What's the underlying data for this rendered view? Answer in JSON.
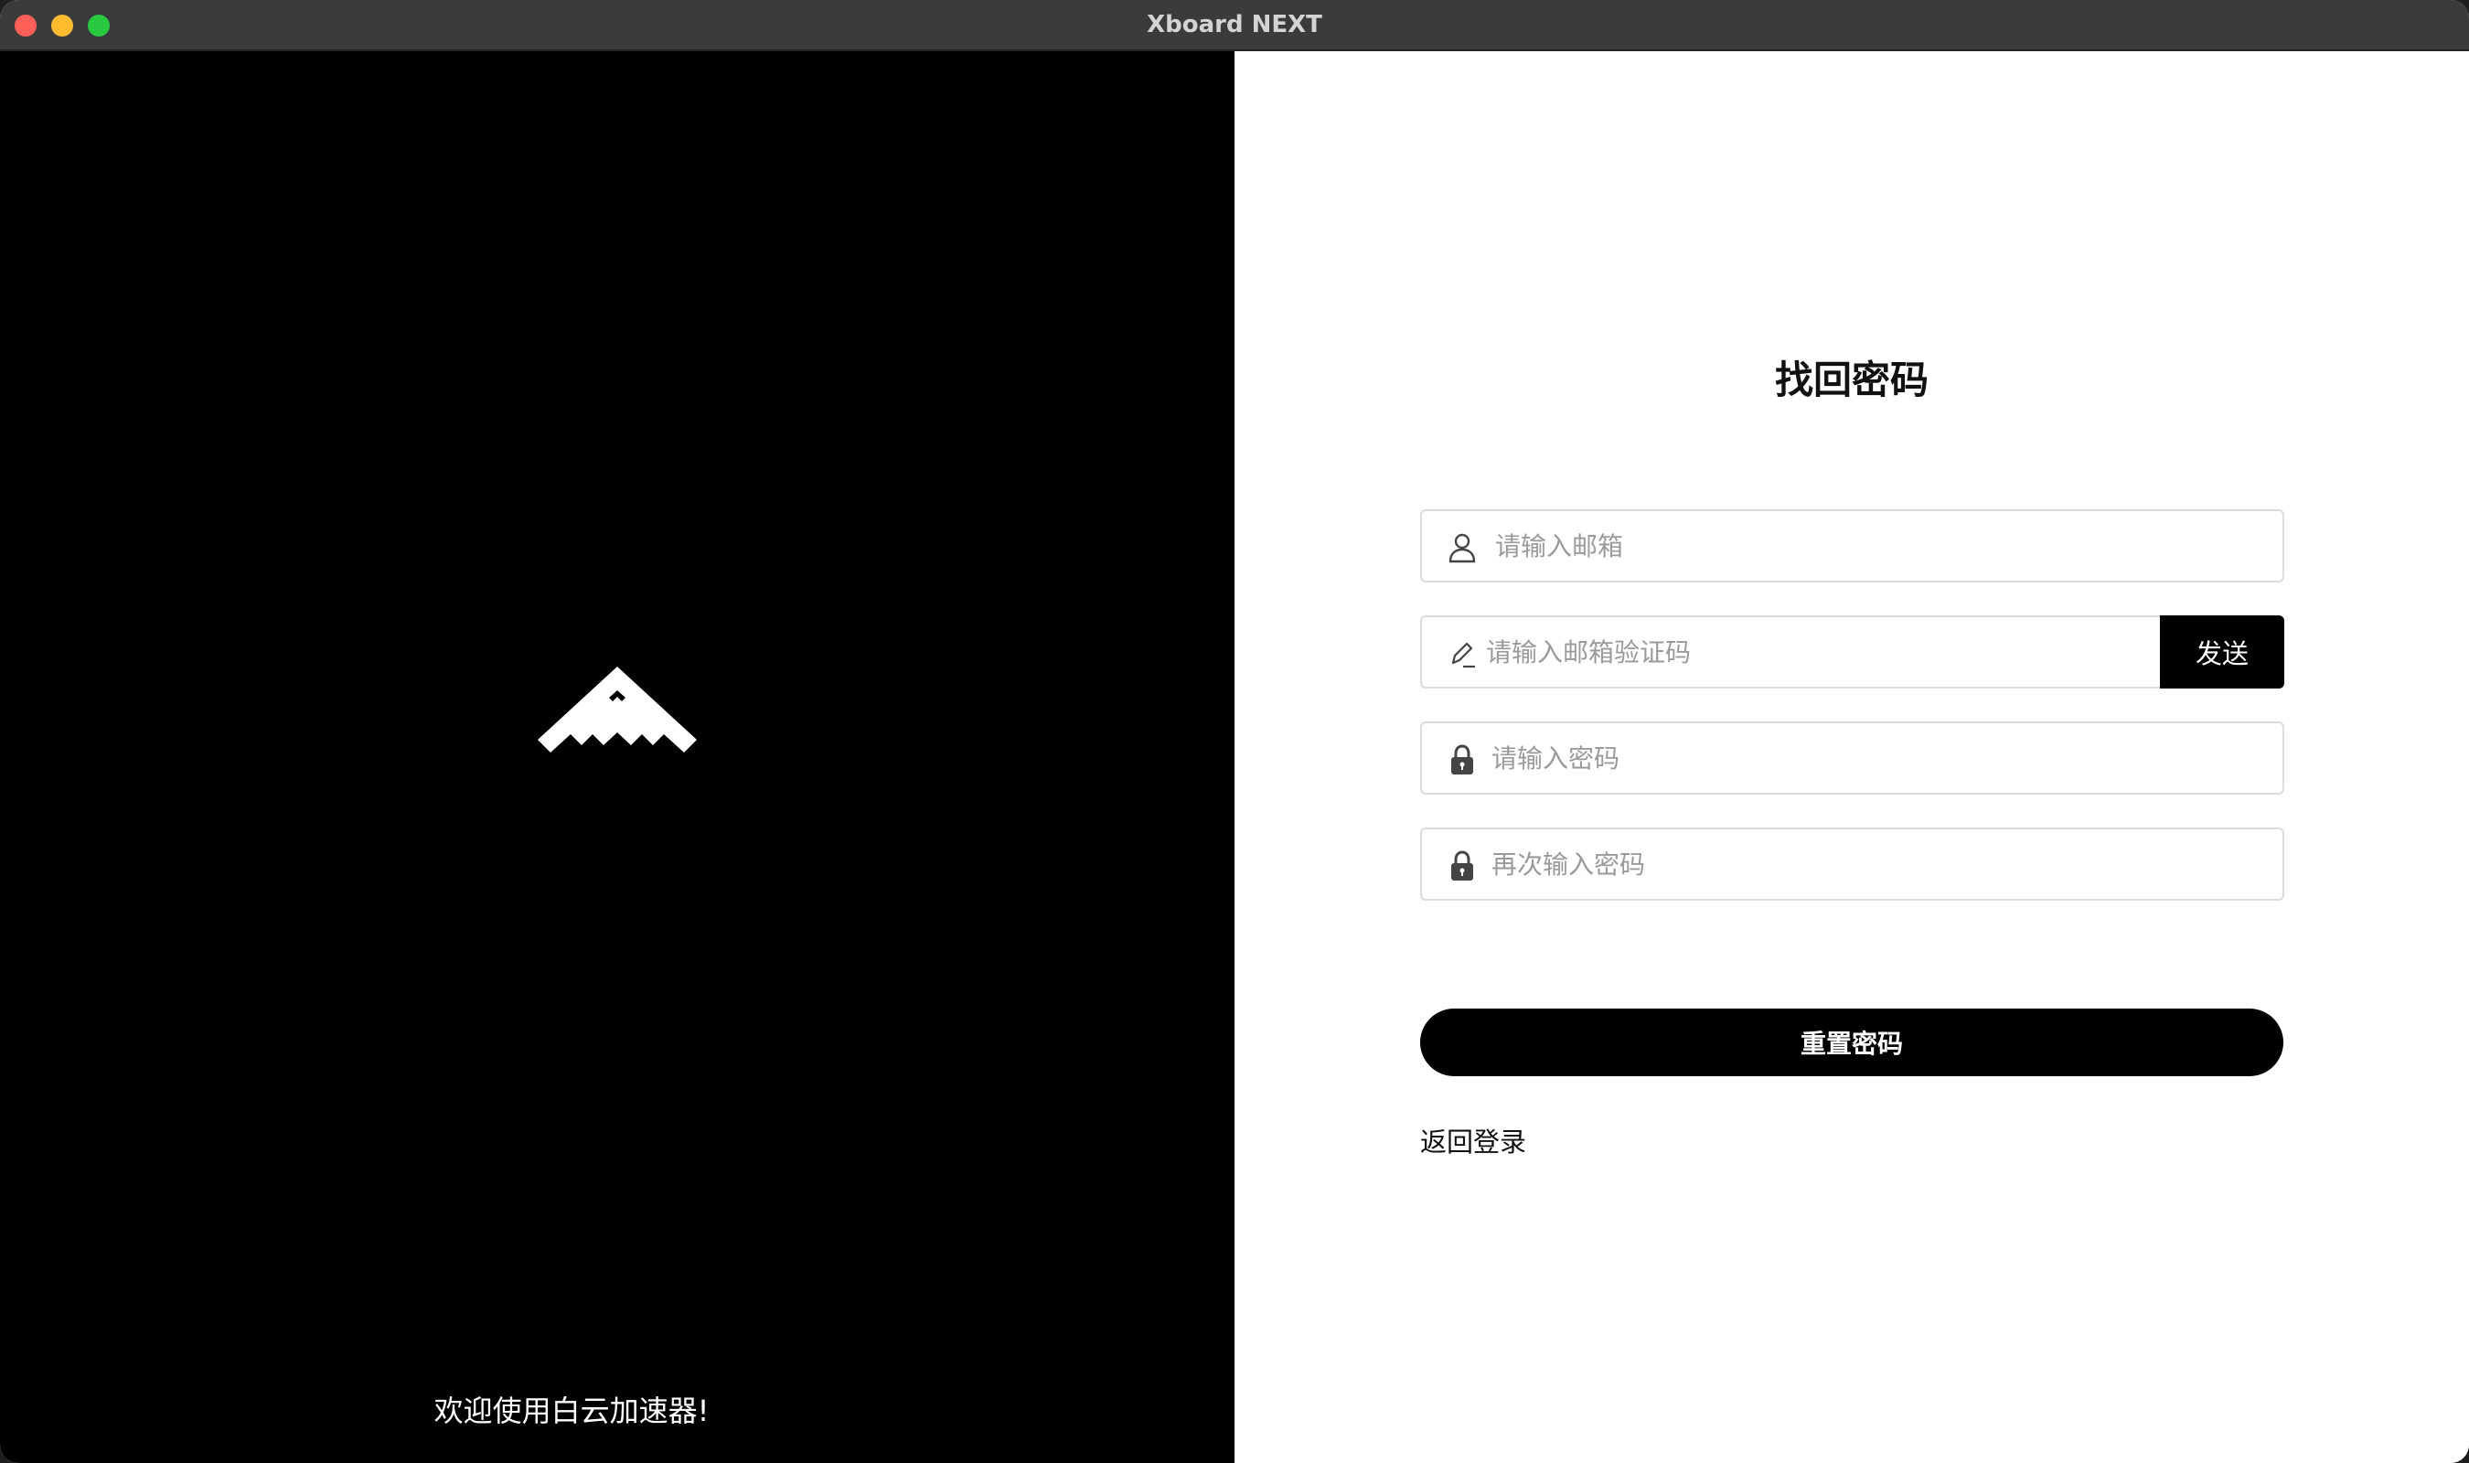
{
  "window": {
    "title": "Xboard NEXT"
  },
  "left": {
    "logo_icon": "stealth-bomber-logo",
    "welcome": "欢迎使用白云加速器!"
  },
  "form": {
    "title": "找回密码",
    "email": {
      "placeholder": "请输入邮箱",
      "icon": "user-icon"
    },
    "code": {
      "placeholder": "请输入邮箱验证码",
      "icon": "pencil-icon",
      "send_label": "发送"
    },
    "password": {
      "placeholder": "请输入密码",
      "icon": "lock-icon"
    },
    "confirm_password": {
      "placeholder": "再次输入密码",
      "icon": "lock-icon"
    },
    "submit_label": "重置密码",
    "back_link": "返回登录"
  },
  "colors": {
    "left_bg": "#000000",
    "right_bg": "#ffffff",
    "button_bg": "#000000",
    "titlebar_bg": "#3b3b3d"
  }
}
